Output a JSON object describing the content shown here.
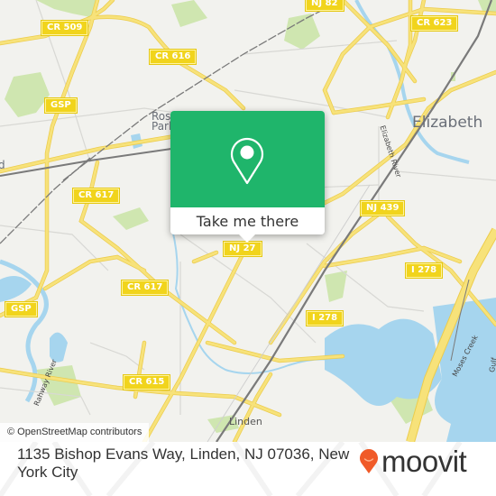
{
  "map": {
    "road_shields": [
      {
        "label": "CR 509"
      },
      {
        "label": "CR 616"
      },
      {
        "label": "NJ 82"
      },
      {
        "label": "CR 623"
      },
      {
        "label": "GSP"
      },
      {
        "label": "CR 617"
      },
      {
        "label": "CR 617"
      },
      {
        "label": "NJ 27"
      },
      {
        "label": "NJ 439"
      },
      {
        "label": "I 278"
      },
      {
        "label": "I 278"
      },
      {
        "label": "GSP"
      },
      {
        "label": "CR 615"
      }
    ],
    "places": {
      "elizabeth": "Elizabeth",
      "roselle_park": "Roselle Park",
      "linden": "Linden",
      "partial_left": "d"
    },
    "water_labels": {
      "elizabeth_river": "Elizabeth River",
      "rahway_river": "Rahway River",
      "moses_creek": "Moses Creek",
      "gulf": "Gulf"
    },
    "colors": {
      "land": "#f2f2ee",
      "road": "#f7e27a",
      "water": "#a6d5ee",
      "park": "#cfe6b0",
      "rail": "#7a7a7a"
    }
  },
  "popup": {
    "icon": "map-pin-icon",
    "action_label": "Take me there",
    "color": "#1fb56b"
  },
  "attribution": "© OpenStreetMap contributors",
  "footer": {
    "address": "1135 Bishop Evans Way, Linden, NJ 07036, New York City",
    "brand": "moovit",
    "brand_color": "#f05a28"
  }
}
